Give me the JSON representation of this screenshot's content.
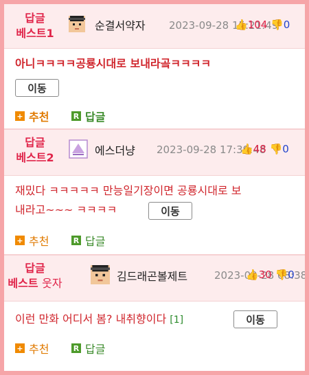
{
  "cards": [
    {
      "best_line1": "답글",
      "best_line2": "베스트1",
      "nickname": "순결서약자",
      "date": "2023-09-28 15:21:49",
      "up": "104",
      "down": "0",
      "text": "아니ㅋㅋㅋㅋ공룡시대로 보내라곸ㅋㅋㅋㅋ",
      "move": "이동",
      "recommend": "추천",
      "reply": "답글"
    },
    {
      "best_line1": "답글",
      "best_line2": "베스트2",
      "nickname": "에스더냥",
      "date": "2023-09-28 17:39:48",
      "up": "48",
      "down": "0",
      "text_line1": "재밌다 ㅋㅋㅋㅋㅋ 만능일기장이면 공룡시대로 보",
      "text_line2": "내라고~~~ ㅋㅋㅋㅋ",
      "move": "이동",
      "recommend": "추천",
      "reply": "답글"
    },
    {
      "best_line1": "답글",
      "best_line2a": "베스트",
      "best_line2b": "웃자",
      "nickname": "김드래곤볼제트",
      "date": "2023-09-28 08:38",
      "up": "30",
      "down": "0",
      "text": "이런 만화 어디서 봄? 내취향이다",
      "count": "[1]",
      "move": "이동",
      "recommend": "추천",
      "reply": "답글"
    }
  ],
  "icons": {
    "up": "thumb-up-icon",
    "down": "thumb-down-icon",
    "recommend": "plus-box-icon",
    "reply": "r-box-icon"
  },
  "colors": {
    "frame": "#f6a5a8",
    "header_bg": "#fdeced",
    "accent_red": "#e0254a",
    "recommend": "#f08a00",
    "reply": "#4d9a2a"
  }
}
